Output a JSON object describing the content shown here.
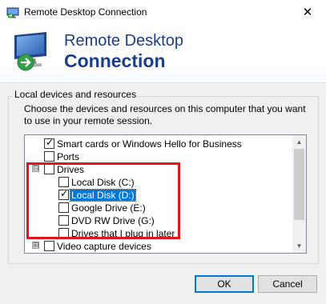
{
  "window": {
    "title": "Remote Desktop Connection"
  },
  "banner": {
    "line1": "Remote Desktop",
    "line2": "Connection"
  },
  "group": {
    "legend": "Local devices and resources",
    "description": "Choose the devices and resources on this computer that you want to use in your remote session."
  },
  "tree": {
    "smart_cards": {
      "label": "Smart cards or Windows Hello for Business",
      "checked": true
    },
    "ports": {
      "label": "Ports",
      "checked": false
    },
    "drives": {
      "label": "Drives",
      "checked": false,
      "expander": "⊟"
    },
    "local_c": {
      "label": "Local Disk (C:)",
      "checked": false
    },
    "local_d": {
      "label": "Local Disk (D:)",
      "checked": true,
      "selected": true
    },
    "google_drive": {
      "label": "Google Drive (E:)",
      "checked": false
    },
    "dvd_drive": {
      "label": "DVD RW Drive (G:)",
      "checked": false
    },
    "later": {
      "label": "Drives that I plug in later",
      "checked": false
    },
    "video": {
      "label": "Video capture devices",
      "checked": false,
      "expander": "⊞"
    }
  },
  "buttons": {
    "ok": "OK",
    "cancel": "Cancel"
  },
  "colors": {
    "accent": "#0078d7",
    "highlight_box": "#e3141b",
    "banner_text": "#1d3d8a"
  }
}
